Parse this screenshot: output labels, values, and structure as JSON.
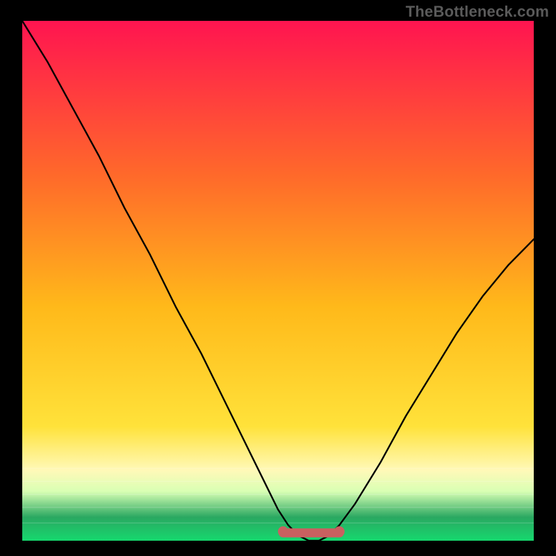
{
  "watermark": "TheBottleneck.com",
  "colors": {
    "background": "#000000",
    "gradient_top": "#ff1450",
    "gradient_upper_mid": "#ff6a2a",
    "gradient_mid": "#ffb91a",
    "gradient_lower_mid": "#ffe23a",
    "gradient_band1": "#fff9b8",
    "gradient_band2": "#d9ffb4",
    "gradient_band_dark": "#2aa861",
    "gradient_bottom": "#16d86e",
    "curve_stroke": "#000000",
    "marker_stroke": "#bb5252",
    "marker_fill": "#c96060"
  },
  "chart_data": {
    "type": "line",
    "title": "",
    "xlabel": "",
    "ylabel": "",
    "xlim": [
      0,
      100
    ],
    "ylim": [
      0,
      100
    ],
    "series": [
      {
        "name": "bottleneck-curve",
        "x": [
          0,
          5,
          10,
          15,
          20,
          25,
          30,
          35,
          40,
          45,
          50,
          52,
          54,
          56,
          58,
          60,
          62,
          65,
          70,
          75,
          80,
          85,
          90,
          95,
          100
        ],
        "values": [
          100,
          92,
          83,
          74,
          64,
          55,
          45,
          36,
          26,
          16,
          6,
          3,
          1,
          0,
          0,
          1,
          3,
          7,
          15,
          24,
          32,
          40,
          47,
          53,
          58
        ]
      }
    ],
    "optimal_band": {
      "x_start": 51,
      "x_end": 62,
      "y": 1.5
    }
  }
}
